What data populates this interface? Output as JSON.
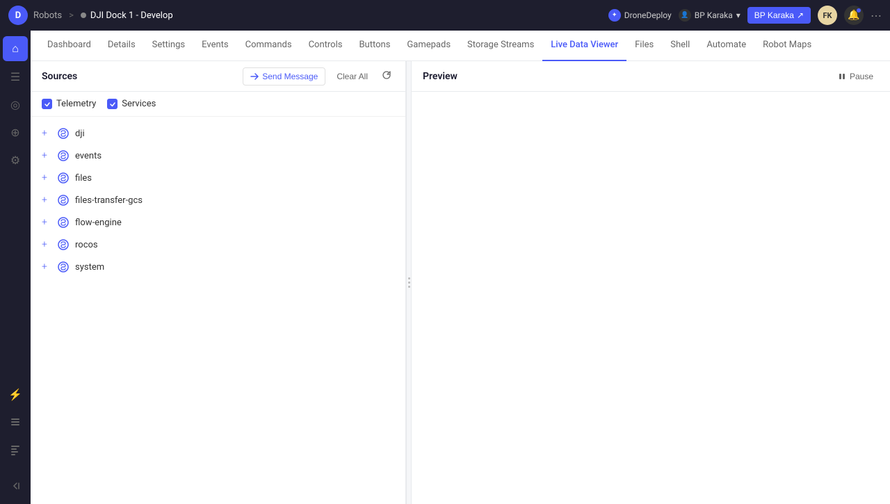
{
  "topbar": {
    "logo_text": "D",
    "robots_label": "Robots",
    "breadcrumb_separator": ">",
    "page_title": "DJI Dock 1 - Develop",
    "drone_deploy_label": "DroneDeploy",
    "user_label": "BP Karaka",
    "bp_button_label": "BP Karaka",
    "bp_button_icon": "↗",
    "avatar_initials": "FK",
    "more_icon": "⋯"
  },
  "tabs": [
    {
      "id": "dashboard",
      "label": "Dashboard",
      "active": false
    },
    {
      "id": "details",
      "label": "Details",
      "active": false
    },
    {
      "id": "settings",
      "label": "Settings",
      "active": false
    },
    {
      "id": "events",
      "label": "Events",
      "active": false
    },
    {
      "id": "commands",
      "label": "Commands",
      "active": false
    },
    {
      "id": "controls",
      "label": "Controls",
      "active": false
    },
    {
      "id": "buttons",
      "label": "Buttons",
      "active": false
    },
    {
      "id": "gamepads",
      "label": "Gamepads",
      "active": false
    },
    {
      "id": "storage-streams",
      "label": "Storage Streams",
      "active": false
    },
    {
      "id": "live-data-viewer",
      "label": "Live Data Viewer",
      "active": true
    },
    {
      "id": "files",
      "label": "Files",
      "active": false
    },
    {
      "id": "shell",
      "label": "Shell",
      "active": false
    },
    {
      "id": "automate",
      "label": "Automate",
      "active": false
    },
    {
      "id": "robot-maps",
      "label": "Robot Maps",
      "active": false
    }
  ],
  "sources_panel": {
    "title": "Sources",
    "send_message_label": "Send Message",
    "clear_all_label": "Clear All",
    "telemetry_label": "Telemetry",
    "services_label": "Services",
    "sources": [
      {
        "id": "dji",
        "name": "dji"
      },
      {
        "id": "events",
        "name": "events"
      },
      {
        "id": "files",
        "name": "files"
      },
      {
        "id": "files-transfer-gcs",
        "name": "files-transfer-gcs"
      },
      {
        "id": "flow-engine",
        "name": "flow-engine"
      },
      {
        "id": "rocos",
        "name": "rocos"
      },
      {
        "id": "system",
        "name": "system"
      }
    ]
  },
  "preview_panel": {
    "title": "Preview",
    "pause_label": "Pause"
  },
  "sidebar": {
    "items": [
      {
        "id": "home",
        "icon": "⌂"
      },
      {
        "id": "list",
        "icon": "☰"
      },
      {
        "id": "activity",
        "icon": "◎"
      },
      {
        "id": "globe",
        "icon": "⊕"
      },
      {
        "id": "gear",
        "icon": "⚙"
      },
      {
        "id": "bolt",
        "icon": "⚡"
      },
      {
        "id": "layers",
        "icon": "⧉"
      },
      {
        "id": "log",
        "icon": "≡"
      }
    ]
  }
}
